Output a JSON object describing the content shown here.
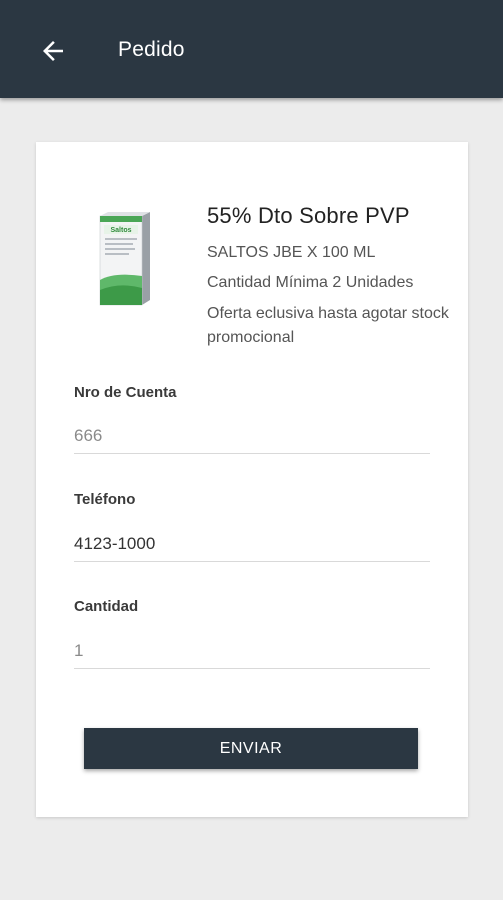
{
  "appbar": {
    "title": "Pedido",
    "back_icon": "arrow-left-icon"
  },
  "product": {
    "image_icon": "medicine-box-image",
    "box_label": "Saltos",
    "offer_title": "55% Dto Sobre PVP",
    "name": "SALTOS JBE X 100 ML",
    "min_quantity": "Cantidad Mínima 2 Unidades",
    "note": "Oferta eclusiva hasta agotar stock promocional"
  },
  "form": {
    "account": {
      "label": "Nro de Cuenta",
      "value": "",
      "placeholder": "666"
    },
    "phone": {
      "label": "Teléfono",
      "value": "4123-1000",
      "placeholder": ""
    },
    "quantity": {
      "label": "Cantidad",
      "value": "",
      "placeholder": "1"
    }
  },
  "submit_label": "ENVIAR",
  "colors": {
    "appbar": "#2b3742",
    "background": "#ececec",
    "card": "#ffffff",
    "button": "#2b3742",
    "box_green": "#3d9a48"
  }
}
